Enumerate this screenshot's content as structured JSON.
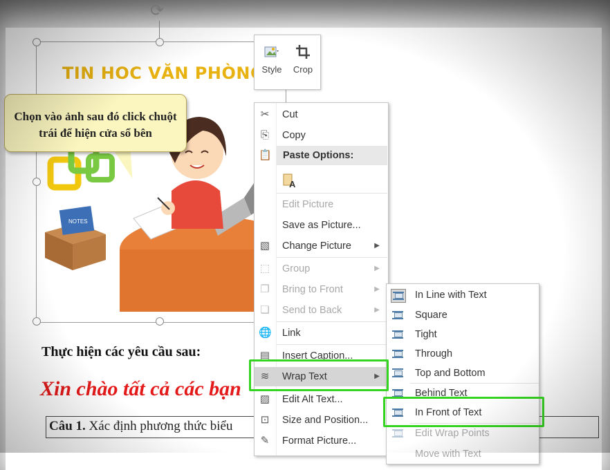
{
  "picture": {
    "title": "TIN HOC VĂN PHÒNG",
    "callout_text": "Chọn vào ảnh sau đó click chuột trái để hiện cửa sổ bên",
    "notes_label": "NOTES"
  },
  "mini_toolbar": {
    "style_label": "Style",
    "crop_label": "Crop"
  },
  "document": {
    "heading": "Thực hiện các yêu cầu sau:",
    "red_text": "Xin chào tất cả các bạn",
    "box_bold": "Câu 1.",
    "box_text": " Xác định phương thức biểu"
  },
  "context_menu": {
    "cut": "Cut",
    "copy": "Copy",
    "paste_options": "Paste Options:",
    "edit_picture": "Edit Picture",
    "save_as_picture": "Save as Picture...",
    "change_picture": "Change Picture",
    "group": "Group",
    "bring_to_front": "Bring to Front",
    "send_to_back": "Send to Back",
    "link": "Link",
    "insert_caption": "Insert Caption...",
    "wrap_text": "Wrap Text",
    "edit_alt_text": "Edit Alt Text...",
    "size_and_position": "Size and Position...",
    "format_picture": "Format Picture..."
  },
  "wrap_submenu": {
    "in_line": "In Line with Text",
    "square": "Square",
    "tight": "Tight",
    "through": "Through",
    "top_bottom": "Top and Bottom",
    "behind": "Behind Text",
    "in_front": "In Front of Text",
    "edit_wrap": "Edit Wrap Points",
    "move_with": "Move with Text"
  },
  "colors": {
    "highlight_green": "#35d421",
    "title_gold": "#e8b210",
    "red_text": "#e41a1a"
  }
}
